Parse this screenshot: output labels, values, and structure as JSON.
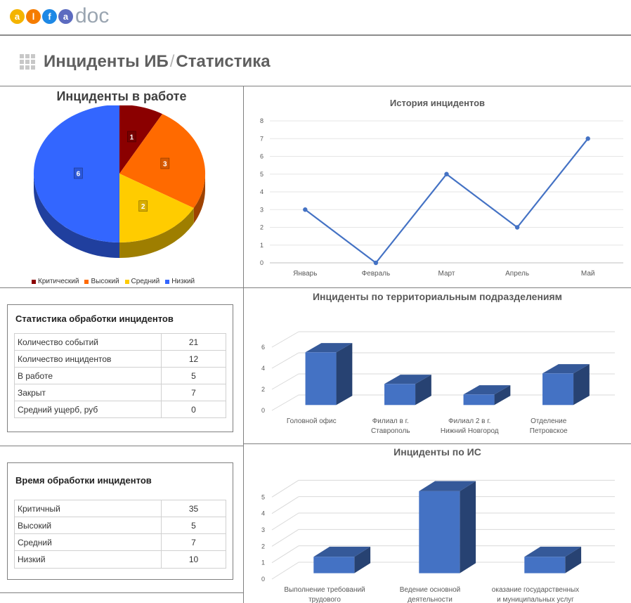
{
  "header": {
    "logo_letters": [
      "a",
      "l",
      "f",
      "a"
    ],
    "logo_word": "doc",
    "logo_colors": [
      "#f4b400",
      "#f57c00",
      "#1e88e5",
      "#5c6bc0"
    ],
    "title_main": "Инциденты ИБ",
    "title_sep": "/",
    "title_sub": "Статистика"
  },
  "pie": {
    "title": "Инциденты в работе",
    "chart_data": {
      "type": "pie",
      "title": "Инциденты в работе",
      "labels": [
        "Критический",
        "Высокий",
        "Средний",
        "Низкий"
      ],
      "values": [
        1,
        3,
        2,
        6
      ],
      "colors": [
        "#8b0000",
        "#ff6a00",
        "#ffcc00",
        "#3366ff"
      ],
      "legend": "bottom"
    }
  },
  "history": {
    "title": "История инцидентов",
    "chart_data": {
      "type": "line",
      "title": "История инцидентов",
      "categories": [
        "Январь",
        "Февраль",
        "Март",
        "Апрель",
        "Май"
      ],
      "values": [
        3,
        0,
        5,
        2,
        7
      ],
      "ylim": [
        0,
        8
      ],
      "yticks": [
        "0",
        "1",
        "2",
        "3",
        "4",
        "5",
        "6",
        "7",
        "8"
      ],
      "color": "#4472c4",
      "grid": true
    }
  },
  "territories": {
    "title": "Инциденты по территориальным подразделениям",
    "chart_data": {
      "type": "bar",
      "title": "Инциденты по территориальным подразделениям",
      "categories": [
        [
          "Головной офис"
        ],
        [
          "Филиал в г.",
          "Ставрополь"
        ],
        [
          "Филиал 2 в г.",
          "Нижний Новгород"
        ],
        [
          "Отделение",
          "Петровское"
        ]
      ],
      "values": [
        5,
        2,
        1,
        3
      ],
      "ylim": [
        0,
        7
      ],
      "yticks": [
        "0",
        "2",
        "4",
        "6"
      ],
      "color": "#4472c4"
    }
  },
  "systems": {
    "title": "Инциденты по ИС",
    "chart_data": {
      "type": "bar",
      "title": "Инциденты по ИС",
      "categories": [
        [
          "Выполнение требований",
          "трудового"
        ],
        [
          "Ведение основной",
          "деятельности"
        ],
        [
          "оказание государственных",
          "и муниципальных услуг"
        ]
      ],
      "values": [
        1,
        5,
        1
      ],
      "ylim": [
        0,
        6
      ],
      "yticks": [
        "0",
        "1",
        "2",
        "3",
        "4",
        "5"
      ],
      "color": "#4472c4"
    }
  },
  "stats_table": {
    "caption": "Статистика обработки инцидентов",
    "rows": [
      {
        "label": "Количество событий",
        "value": "21"
      },
      {
        "label": "Количество инцидентов",
        "value": "12"
      },
      {
        "label": "В работе",
        "value": "5"
      },
      {
        "label": "Закрыт",
        "value": "7"
      },
      {
        "label": "Средний ущерб, руб",
        "value": "0"
      }
    ]
  },
  "time_table": {
    "caption": "Время обработки инцидентов",
    "rows": [
      {
        "label": "Критичный",
        "value": "35"
      },
      {
        "label": "Высокий",
        "value": "5"
      },
      {
        "label": "Средний",
        "value": "7"
      },
      {
        "label": "Низкий",
        "value": "10"
      }
    ]
  }
}
